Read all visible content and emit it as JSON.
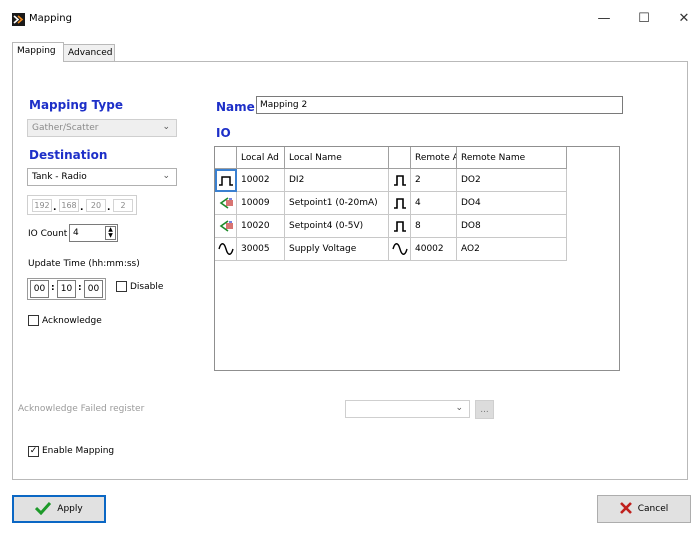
{
  "window": {
    "title": "Mapping",
    "minimize": "—",
    "maximize": "☐",
    "close": "✕"
  },
  "tabs": [
    {
      "label": "Mapping"
    },
    {
      "label": "Advanced"
    }
  ],
  "mapping_type": {
    "title": "Mapping Type",
    "value": "Gather/Scatter"
  },
  "destination": {
    "title": "Destination",
    "value": "Tank - Radio",
    "ip": [
      "192",
      "168",
      "20",
      "2"
    ]
  },
  "io_count": {
    "label": "IO Count",
    "value": "4"
  },
  "update_time": {
    "label": "Update Time  (hh:mm:ss)",
    "hh": "00",
    "mm": "10",
    "ss": "00",
    "sep": ":",
    "disable_label": "Disable"
  },
  "acknowledge": {
    "label": "Acknowledge"
  },
  "name": {
    "label": "Name",
    "value": "Mapping 2"
  },
  "io": {
    "title": "IO",
    "columns": [
      "Local Ad",
      "Local Name",
      "Remote A",
      "Remote Name"
    ],
    "rows": [
      {
        "local_icon": "square-wave-icon",
        "local_addr": "10002",
        "local_name": "DI2",
        "remote_icon": "square-wave-icon",
        "remote_addr": "2",
        "remote_name": "DO2"
      },
      {
        "local_icon": "analog-input-icon",
        "local_addr": "10009",
        "local_name": "Setpoint1 (0-20mA)",
        "remote_icon": "square-wave-icon",
        "remote_addr": "4",
        "remote_name": "DO4"
      },
      {
        "local_icon": "analog-input-icon",
        "local_addr": "10020",
        "local_name": "Setpoint4 (0-5V)",
        "remote_icon": "square-wave-icon",
        "remote_addr": "8",
        "remote_name": "DO8"
      },
      {
        "local_icon": "sine-wave-icon",
        "local_addr": "30005",
        "local_name": "Supply Voltage",
        "remote_icon": "sine-wave-icon",
        "remote_addr": "40002",
        "remote_name": "AO2"
      }
    ]
  },
  "ack_failed": {
    "label": "Acknowledge Failed register",
    "browse": "..."
  },
  "enable_mapping": {
    "label": "Enable Mapping",
    "checked": true
  },
  "buttons": {
    "apply": "Apply",
    "cancel": "Cancel"
  },
  "colors": {
    "accent_title": "#1d2fc8",
    "apply_border": "#0b67c4",
    "cancel_x": "#c0201d",
    "apply_check": "#1e9a2a"
  }
}
